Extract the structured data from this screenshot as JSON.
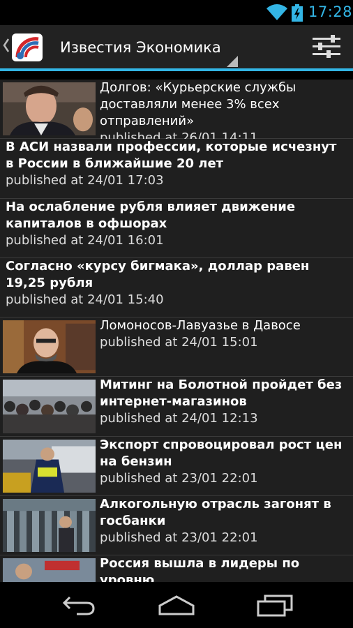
{
  "status_bar": {
    "time": "17:28"
  },
  "action_bar": {
    "title": "Известия Экономика"
  },
  "articles": [
    {
      "title": "Долгов: «Курьерские службы доставляли менее 3% всех отправлений»",
      "published": "published at 26/01 14:11",
      "has_image": true
    },
    {
      "title": "В АСИ назвали профессии, которые исчезнут в России в ближайшие 20 лет",
      "published": "published at 24/01 17:03",
      "has_image": false
    },
    {
      "title": "На ослабление рубля влияет движение капиталов в офшорах",
      "published": "published at 24/01 16:01",
      "has_image": false
    },
    {
      "title": "Согласно «курсу бигмака», доллар равен 19,25 рубля",
      "published": "published at 24/01 15:40",
      "has_image": false
    },
    {
      "title": "Ломоносов-Лавуазье в Давосе",
      "published": "published at 24/01 15:01",
      "has_image": true
    },
    {
      "title": "Митинг на Болотной пройдет без интернет-магазинов",
      "published": "published at 24/01 12:13",
      "has_image": true
    },
    {
      "title": "Экспорт спровоцировал рост цен на бензин",
      "published": "published at 23/01 22:01",
      "has_image": true
    },
    {
      "title": "Алкогольную отрасль загонят в госбанки",
      "published": "published at 23/01 22:01",
      "has_image": true
    },
    {
      "title": "Россия вышла в лидеры по уровню",
      "published": "",
      "has_image": true
    }
  ],
  "colors": {
    "accent": "#33b5e5",
    "background": "#1f1f1f"
  },
  "icons": {
    "status": [
      "wifi-icon",
      "battery-icon"
    ],
    "action_bar": [
      "up-caret-icon",
      "app-logo-icon",
      "settings-sliders-icon"
    ],
    "nav": [
      "back-icon",
      "home-icon",
      "recent-apps-icon"
    ]
  }
}
